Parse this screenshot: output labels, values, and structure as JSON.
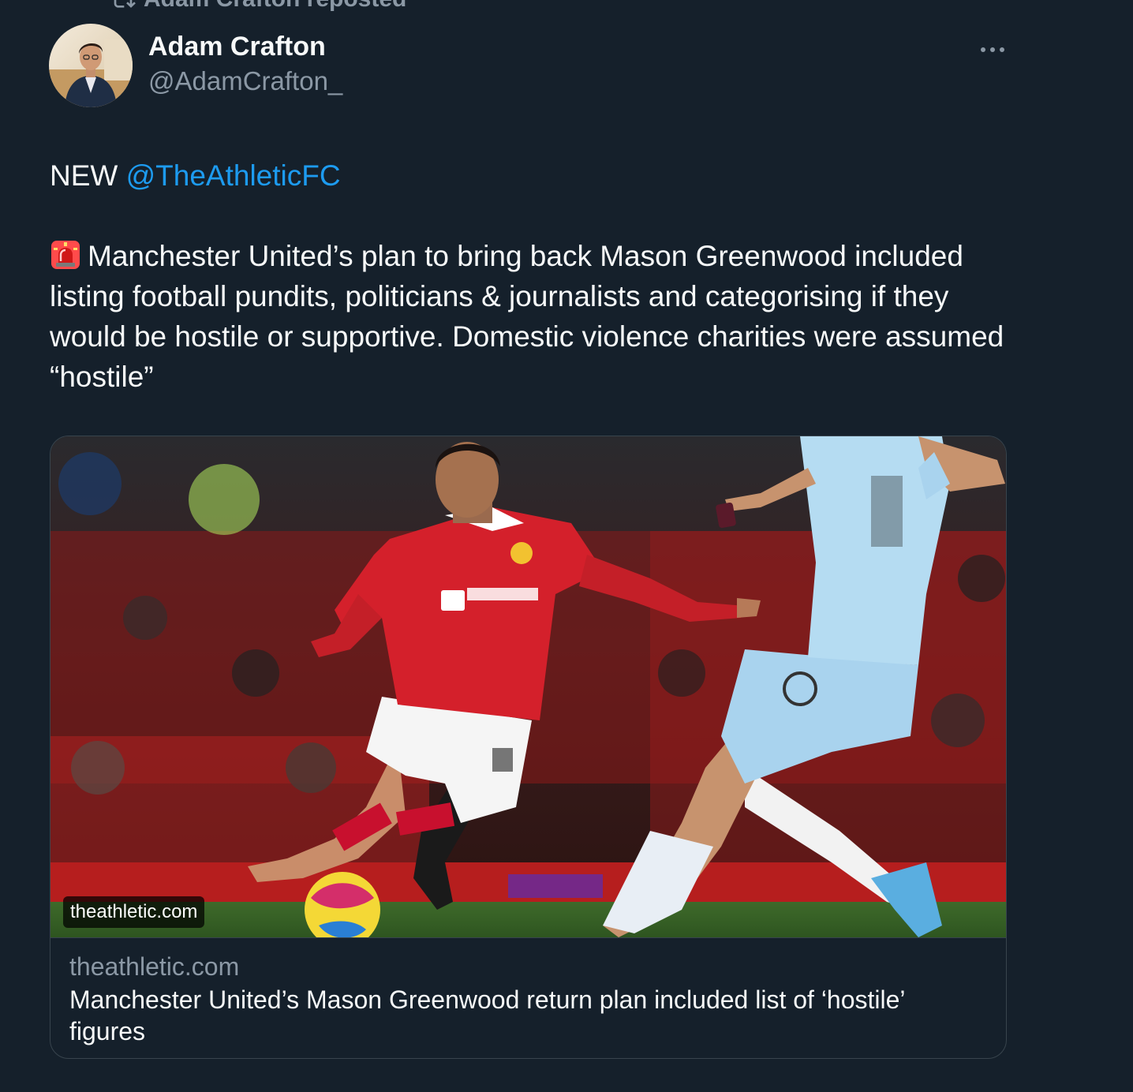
{
  "repost": {
    "label": "Adam Crafton reposted",
    "icon": "repost-icon"
  },
  "author": {
    "name": "Adam Crafton",
    "handle": "@AdamCrafton_",
    "avatar_icon": "avatar-photo"
  },
  "menu": {
    "icon": "more-options-icon"
  },
  "tweet": {
    "prefix": "NEW",
    "mention": "@TheAthleticFC",
    "emoji": "police-light-icon",
    "body": "Manchester United’s plan to bring back Mason Greenwood included listing football pundits, politicians & journalists and categorising if they would be hostile or supportive. Domestic violence charities were assumed “hostile”"
  },
  "card": {
    "image_icon": "football-match-photo",
    "image_badge": "theathletic.com",
    "domain": "theathletic.com",
    "title": "Manchester United’s Mason Greenwood return plan included list of ‘hostile’ figures"
  },
  "colors": {
    "background": "#15202b",
    "text_primary": "#f7f9f9",
    "text_secondary": "#8b98a5",
    "link": "#1d9bf0",
    "border": "#38444d"
  }
}
